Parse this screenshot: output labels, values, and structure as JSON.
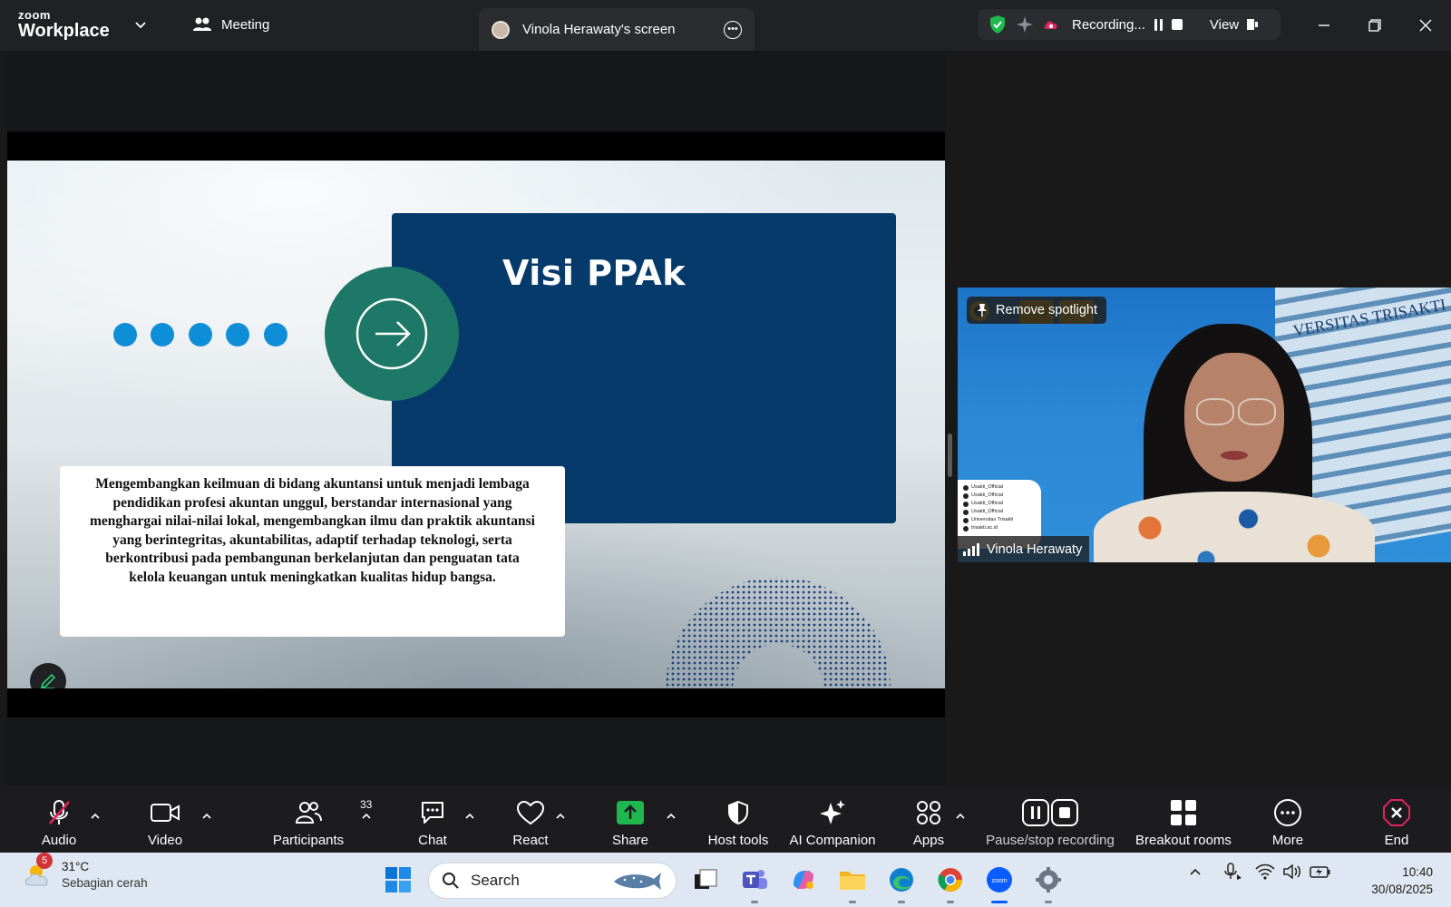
{
  "app": {
    "brand_top": "zoom",
    "brand_bottom": "Workplace",
    "meeting_label": "Meeting",
    "share_tab_title": "Vinola Herawaty's screen"
  },
  "recording": {
    "status": "Recording...",
    "view_label": "View"
  },
  "slide": {
    "title": "Visi PPAk",
    "body": "Mengembangkan keilmuan di bidang akuntansi untuk menjadi lembaga pendidikan profesi akuntan unggul, berstandar internasional yang menghargai nilai-nilai lokal, mengembangkan ilmu dan praktik akuntansi yang berintegritas, akuntabilitas, adaptif terhadap teknologi, serta berkontribusi pada pembangunan berkelanjutan dan penguatan tata kelola keuangan untuk meningkatkan kualitas hidup bangsa.",
    "colors": {
      "title_box": "#053a6b",
      "circle": "#1d7868",
      "dots": "#0f8ed8"
    }
  },
  "video": {
    "spotlight_label": "Remove spotlight",
    "participant_name": "Vinola Herawaty",
    "background_text": "VERSITAS TRISAKTI",
    "social_handles": [
      "Usakti_Official",
      "Usakti_Official",
      "Usakti_Official",
      "Usakti_Official",
      "Universitas Trisakti",
      "trisakti.ac.id"
    ]
  },
  "toolbar": {
    "audio": "Audio",
    "video": "Video",
    "participants": "Participants",
    "participants_count": "33",
    "chat": "Chat",
    "react": "React",
    "share": "Share",
    "host_tools": "Host tools",
    "ai_companion": "AI Companion",
    "apps": "Apps",
    "pause_stop": "Pause/stop recording",
    "breakout": "Breakout rooms",
    "more": "More",
    "end": "End",
    "colors": {
      "share": "#1fb84f",
      "end": "#e0245e",
      "muted": "#e0245e"
    }
  },
  "taskbar": {
    "weather_badge": "5",
    "temperature": "31°C",
    "weather_desc": "Sebagian cerah",
    "search_placeholder": "Search",
    "time": "10:40",
    "date": "30/08/2025"
  }
}
